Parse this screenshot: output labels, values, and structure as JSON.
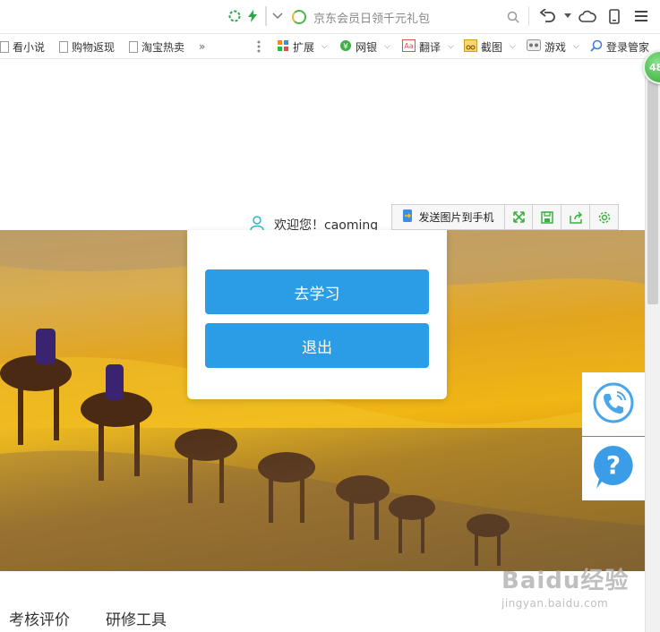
{
  "browser": {
    "address_placeholder": "京东会员日领千元礼包",
    "bookmarks": [
      {
        "label": "看小说"
      },
      {
        "label": "购物返现"
      },
      {
        "label": "淘宝热卖"
      }
    ],
    "more_label": "»",
    "extensions": [
      {
        "label": "扩展",
        "icon": "puzzle-icon"
      },
      {
        "label": "网银",
        "icon": "bank-icon"
      },
      {
        "label": "翻译",
        "icon": "translate-icon"
      },
      {
        "label": "截图",
        "icon": "scissors-icon"
      },
      {
        "label": "游戏",
        "icon": "gamepad-icon"
      },
      {
        "label": "登录管家",
        "icon": "key-icon"
      }
    ],
    "badge_count": "48"
  },
  "image_toolbar": {
    "send_label": "发送图片到手机"
  },
  "page": {
    "welcome_text": "欢迎您！caoming",
    "study_button": "去学习",
    "logout_button": "退出",
    "footer_items": [
      "考核评价",
      "研修工具"
    ]
  },
  "watermark": {
    "brand": "Baidu经验",
    "url": "jingyan.baidu.com"
  },
  "colors": {
    "primary_button": "#2b9de6",
    "accent_green": "#3cb043"
  }
}
